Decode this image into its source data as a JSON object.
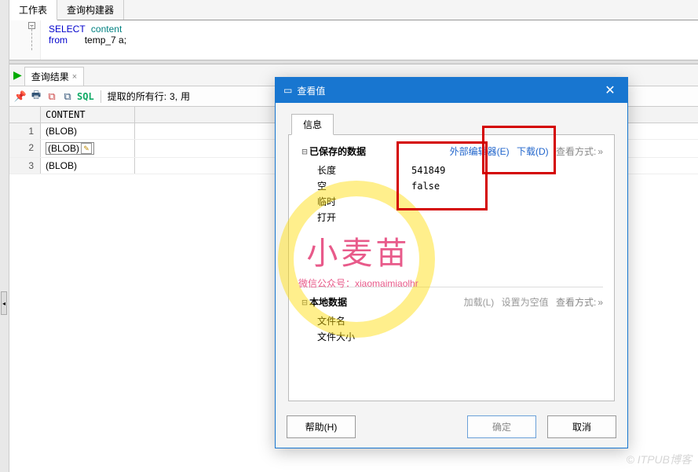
{
  "tabs": {
    "worksheet": "工作表",
    "query_builder": "查询构建器"
  },
  "sql": {
    "select_kw": "SELECT",
    "select_col": "content",
    "from_kw": "from",
    "from_tbl": "temp_7 a;"
  },
  "result": {
    "tab_label": "查询结果",
    "sql_badge": "SQL",
    "status_prefix": "提取的所有行:",
    "row_count": "3,",
    "status_suffix": "用",
    "column_header": "CONTENT",
    "rows": [
      {
        "n": "1",
        "val": "(BLOB)",
        "selected": false
      },
      {
        "n": "2",
        "val": "(BLOB)",
        "selected": true
      },
      {
        "n": "3",
        "val": "(BLOB)",
        "selected": false
      }
    ]
  },
  "dialog": {
    "title": "查看值",
    "info_tab": "信息",
    "saved_section": "已保存的数据",
    "external_editor": "外部编辑器(E)",
    "download": "下载(D)",
    "view_mode": "查看方式:",
    "arrow": "»",
    "length_label": "长度",
    "length_val": "541849",
    "null_label": "空",
    "null_val": "false",
    "temp_label": "临时",
    "open_label": "打开",
    "local_section": "本地数据",
    "load": "加载(L)",
    "set_null": "设置为空值",
    "filename_label": "文件名",
    "filesize_label": "文件大小",
    "help": "帮助(H)",
    "ok": "确定",
    "cancel": "取消"
  },
  "watermark": {
    "main": "小麦苗",
    "sub_prefix": "微信公众号：",
    "sub_id": "xiaomaimiaolhr",
    "corner": "© ITPUB博客"
  }
}
